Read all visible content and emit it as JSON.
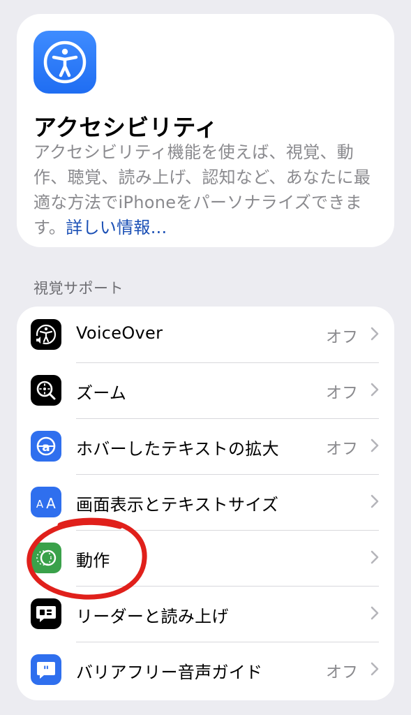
{
  "header": {
    "icon": "accessibility-icon",
    "title": "アクセシビリティ",
    "description_lines": [
      "アクセシビリティ機能を使えば、視覚、動",
      "作、聴覚、読み上げ、認知など、あなたに最",
      "適な方法でiPhoneをパーソナライズできま"
    ],
    "description_last": "す。",
    "learn_more": "詳しい情報...",
    "accent_color": "#1f6df2"
  },
  "section": {
    "title": "視覚サポート",
    "items": [
      {
        "icon": "voiceover-icon",
        "label": "VoiceOver",
        "value": "オフ"
      },
      {
        "icon": "zoom-icon",
        "label": "ズーム",
        "value": "オフ"
      },
      {
        "icon": "hover-text-icon",
        "label": "ホバーしたテキストの拡大",
        "value": "オフ"
      },
      {
        "icon": "display-text-size-icon",
        "label": "画面表示とテキストサイズ",
        "value": ""
      },
      {
        "icon": "motion-icon",
        "label": "動作",
        "value": ""
      },
      {
        "icon": "spoken-content-icon",
        "label": "リーダーと読み上げ",
        "value": ""
      },
      {
        "icon": "audio-descriptions-icon",
        "label": "バリアフリー音声ガイド",
        "value": "オフ"
      }
    ]
  },
  "annotation": {
    "color": "#e0201b"
  }
}
